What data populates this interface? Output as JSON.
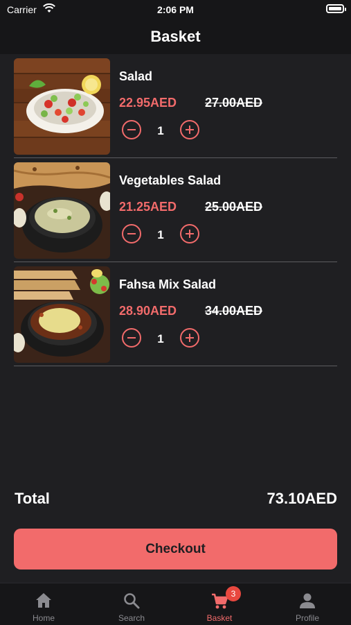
{
  "status": {
    "carrier": "Carrier",
    "time": "2:06 PM"
  },
  "header": {
    "title": "Basket"
  },
  "items": [
    {
      "name": "Salad",
      "price": "22.95AED",
      "old_price": "27.00AED",
      "qty": "1",
      "image": "salad-bowl"
    },
    {
      "name": "Vegetables Salad",
      "price": "21.25AED",
      "old_price": "25.00AED",
      "qty": "1",
      "image": "soup-pot-with-bread"
    },
    {
      "name": "Fahsa Mix Salad",
      "price": "28.90AED",
      "old_price": "34.00AED",
      "qty": "1",
      "image": "stew-pot-with-bread"
    }
  ],
  "summary": {
    "total_label": "Total",
    "total_value": "73.10AED"
  },
  "checkout": {
    "label": "Checkout"
  },
  "tabs": [
    {
      "label": "Home",
      "icon": "home-icon"
    },
    {
      "label": "Search",
      "icon": "search-icon"
    },
    {
      "label": "Basket",
      "icon": "cart-icon",
      "badge": "3",
      "active": true
    },
    {
      "label": "Profile",
      "icon": "profile-icon"
    }
  ],
  "colors": {
    "accent": "#f26b6b",
    "background": "#1f1f22",
    "bar": "#161618",
    "badge": "#e8483f"
  }
}
